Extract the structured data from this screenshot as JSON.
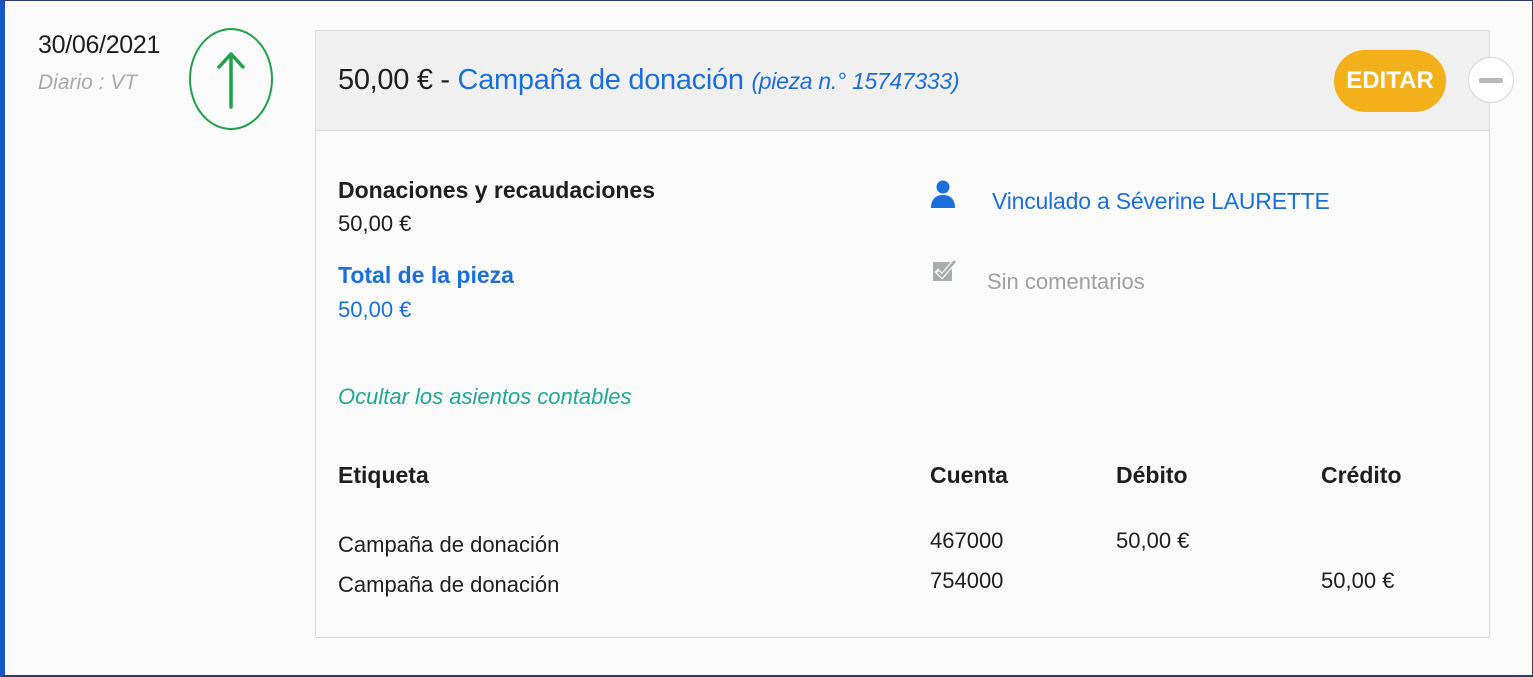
{
  "entry": {
    "date": "30/06/2021",
    "journal": "Diario : VT",
    "direction_icon": "arrow-up-icon",
    "header": {
      "amount": "50,00 €",
      "separator": " - ",
      "title": "Campaña de donación",
      "piece": "(pieza n.° 15747333)"
    },
    "edit_label": "EDITAR",
    "collapse_icon": "minus-icon",
    "category": {
      "label": "Donaciones y recaudaciones",
      "value": "50,00 €"
    },
    "total": {
      "label": "Total de la pieza",
      "value": "50,00 €"
    },
    "linked": {
      "icon": "user-icon",
      "text": "Vinculado a Séverine LAURETTE"
    },
    "comments": {
      "icon": "edit-note-icon",
      "text": "Sin comentarios"
    },
    "toggle_link": "Ocultar los asientos contables",
    "ledger": {
      "headers": {
        "label": "Etiqueta",
        "account": "Cuenta",
        "debit": "Débito",
        "credit": "Crédito"
      },
      "rows": [
        {
          "label": "Campaña de donación",
          "account": "467000",
          "debit": "50,00 €",
          "credit": ""
        },
        {
          "label": "Campaña de donación",
          "account": "754000",
          "debit": "",
          "credit": "50,00 €"
        }
      ]
    }
  },
  "colors": {
    "accent_blue": "#1b6fdc",
    "edit_button": "#f3b01b",
    "arrow_green": "#21a04a",
    "toggle_teal": "#1ea891",
    "left_border": "#1d55c8"
  }
}
